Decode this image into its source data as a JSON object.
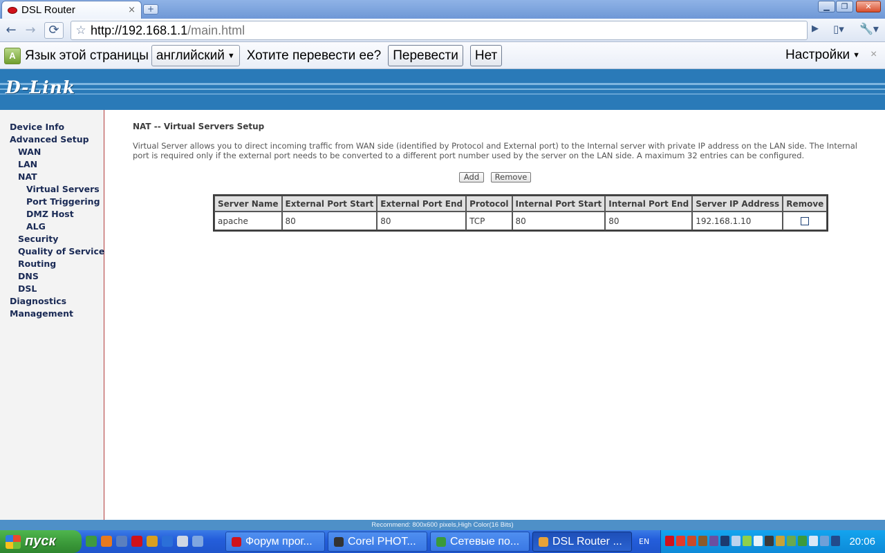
{
  "browser": {
    "tab_title": "DSL Router",
    "tab_close": "×",
    "new_tab": "+",
    "url_host": "http://192.168.1.1",
    "url_path": "/main.html"
  },
  "translate_bar": {
    "label": "Язык этой страницы",
    "language": "английский",
    "question": "Хотите перевести ее?",
    "translate_btn": "Перевести",
    "no_btn": "Нет",
    "settings": "Настройки",
    "close": "×"
  },
  "router": {
    "logo": "D-Link",
    "sidebar": [
      {
        "label": "Device Info",
        "level": 0
      },
      {
        "label": "Advanced Setup",
        "level": 0
      },
      {
        "label": "WAN",
        "level": 1
      },
      {
        "label": "LAN",
        "level": 1
      },
      {
        "label": "NAT",
        "level": 1
      },
      {
        "label": "Virtual Servers",
        "level": 2
      },
      {
        "label": "Port Triggering",
        "level": 2
      },
      {
        "label": "DMZ Host",
        "level": 2
      },
      {
        "label": "ALG",
        "level": 2
      },
      {
        "label": "Security",
        "level": 1
      },
      {
        "label": "Quality of Service",
        "level": 1
      },
      {
        "label": "Routing",
        "level": 1
      },
      {
        "label": "DNS",
        "level": 1
      },
      {
        "label": "DSL",
        "level": 1
      },
      {
        "label": "Diagnostics",
        "level": 0
      },
      {
        "label": "Management",
        "level": 0
      }
    ],
    "page_title": "NAT -- Virtual Servers Setup",
    "description": "Virtual Server allows you to direct incoming traffic from WAN side (identified by Protocol and External port) to the Internal server with private IP address on the LAN side. The Internal port is required only if the external port needs to be converted to a different port number used by the server on the LAN side. A maximum 32 entries can be configured.",
    "add_btn": "Add",
    "remove_btn": "Remove",
    "table": {
      "headers": [
        "Server Name",
        "External Port Start",
        "External Port End",
        "Protocol",
        "Internal Port Start",
        "Internal Port End",
        "Server IP Address",
        "Remove"
      ],
      "rows": [
        [
          "apache",
          "80",
          "80",
          "TCP",
          "80",
          "80",
          "192.168.1.10"
        ]
      ]
    },
    "footer": "Recommend: 800x600 pixels,High Color(16 Bits)"
  },
  "taskbar": {
    "start": "пуск",
    "tasks": [
      {
        "label": "Форум прог...",
        "icon_color": "#d0121b"
      },
      {
        "label": "Corel PHOT...",
        "icon_color": "#333333"
      },
      {
        "label": "Сетевые по...",
        "icon_color": "#3a9a3a"
      },
      {
        "label": "DSL Router ...",
        "icon_color": "#e8a33a"
      }
    ],
    "lang": "EN",
    "clock": "20:06"
  }
}
